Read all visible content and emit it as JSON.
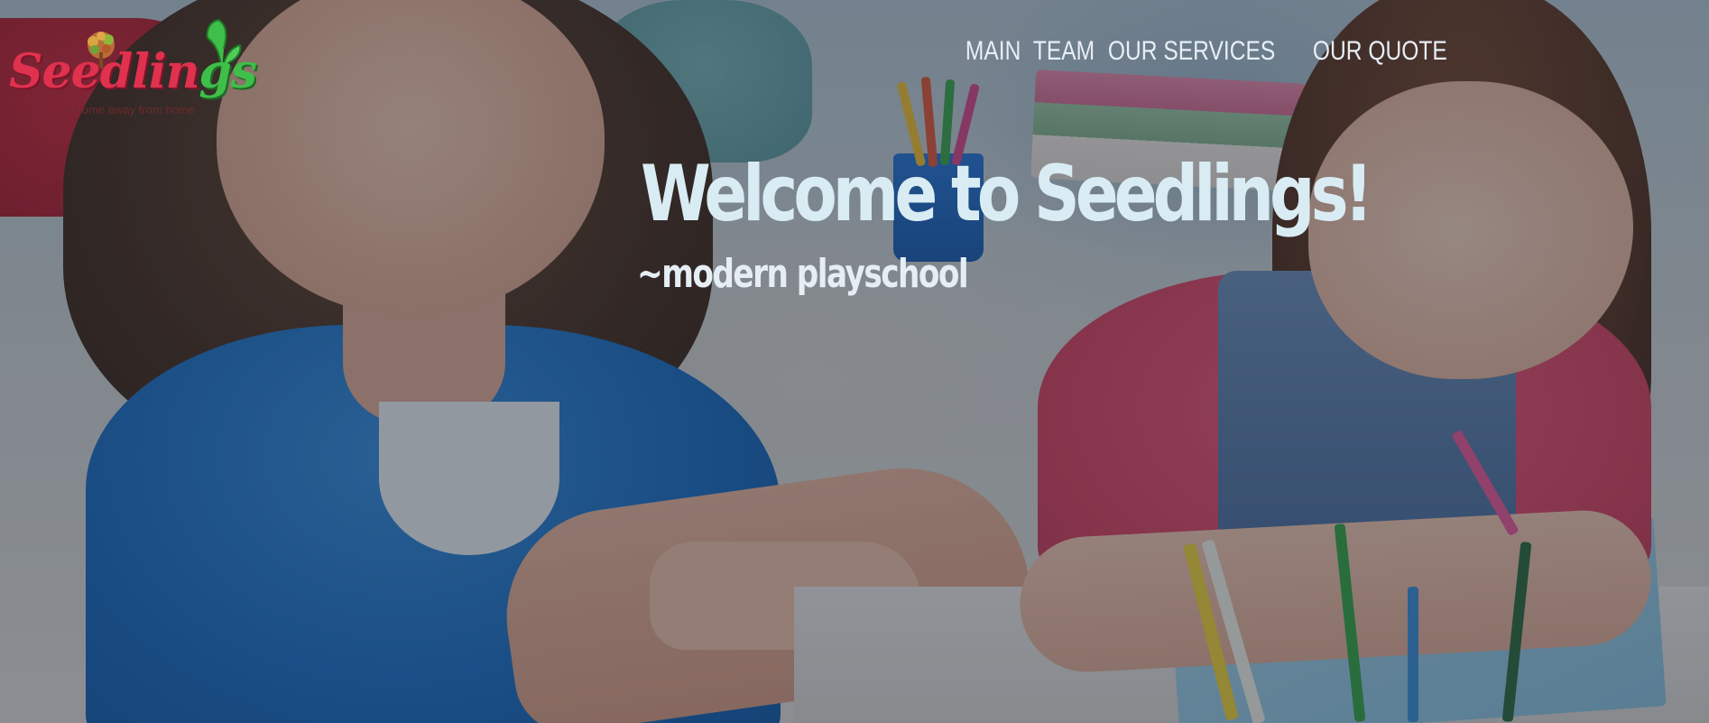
{
  "logo": {
    "wordmark": "Seedlings",
    "tagline": "A home away from home",
    "tree_icon": "tree-icon",
    "leaf_icon": "leaf-icon",
    "colors": {
      "wordmark_red": "#e0314f",
      "wordmark_green": "#3fbf4a"
    }
  },
  "nav": {
    "items": [
      {
        "label": "MAIN"
      },
      {
        "label": "TEAM"
      },
      {
        "label": "OUR SERVICES"
      },
      {
        "label": "OUR QUOTE"
      }
    ],
    "color": "#e7eef6"
  },
  "hero": {
    "title": "Welcome to Seedlings!",
    "subtitle": "~modern playschool",
    "background": "classroom-children-photo",
    "overlay_color": "#141e30"
  }
}
